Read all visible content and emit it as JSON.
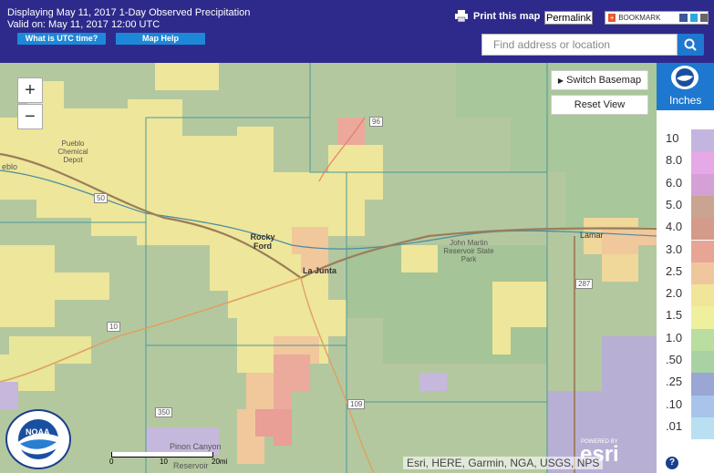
{
  "header": {
    "title": "Displaying May 11, 2017 1-Day Observed Precipitation",
    "valid": "Valid on: May 11, 2017 12:00 UTC",
    "utc_button": "What is UTC time?",
    "help_button": "Map Help",
    "print_label": "Print this map",
    "permalink_label": "Permalink",
    "bookmark_label": "BOOKMARK",
    "search_placeholder": "Find address or location"
  },
  "map": {
    "zoom_in": "+",
    "zoom_out": "−",
    "switch_basemap": "Switch Basemap",
    "reset_view": "Reset View",
    "places": {
      "pueblo_depot": "Pueblo Chemical Depot",
      "pueblo": "eblo",
      "rocky_ford": "Rocky Ford",
      "la_junta": "La Junta",
      "john_martin": "John Martin Reservoir State Park",
      "lamar": "Lamar",
      "pinon_canyon": "Pinon Canyon",
      "reservoir": "Reservoir"
    },
    "road_labels": [
      "50",
      "96",
      "10",
      "350",
      "109",
      "287"
    ],
    "scale_labels": [
      "0",
      "10",
      "20mi"
    ],
    "attribution": "Esri, HERE, Garmin, NGA, USGS, NPS",
    "powered_by": "POWERED BY",
    "esri": "esri",
    "noaa": "NOAA",
    "help_icon": "?"
  },
  "legend": {
    "unit": "Inches",
    "noaa_badge": "NOAA",
    "levels": [
      "10",
      "8.0",
      "6.0",
      "5.0",
      "4.0",
      "3.0",
      "2.5",
      "2.0",
      "1.5",
      "1.0",
      ".50",
      ".25",
      ".10",
      ".01"
    ],
    "colors": [
      "#c4b5e0",
      "#e6a8e6",
      "#d4a0d6",
      "#c9a490",
      "#d49a8a",
      "#e8a596",
      "#f0c79c",
      "#f1e59a",
      "#eef09e",
      "#b9dea0",
      "#a8d2a2",
      "#9aa6d4",
      "#a8c4ea",
      "#b8e0f0"
    ]
  }
}
